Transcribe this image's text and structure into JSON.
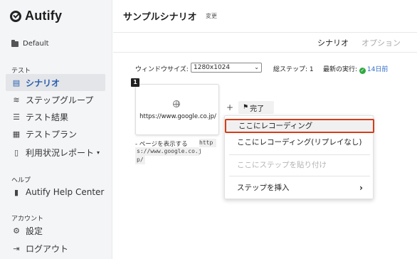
{
  "app": {
    "brand": "Autify"
  },
  "sidebar": {
    "project": "Default",
    "section_test": "テスト",
    "items": [
      {
        "label": "シナリオ",
        "icon": "scenario-icon"
      },
      {
        "label": "ステップグループ",
        "icon": "layers-icon"
      },
      {
        "label": "テスト結果",
        "icon": "list-icon"
      },
      {
        "label": "テストプラン",
        "icon": "calendar-icon"
      },
      {
        "label": "利用状況レポート",
        "icon": "report-icon",
        "caret": "▾"
      }
    ],
    "section_help": "ヘルプ",
    "help_item": "Autify Help Center",
    "section_account": "アカウント",
    "account_items": [
      {
        "label": "設定",
        "icon": "gear-icon"
      },
      {
        "label": "ログアウト",
        "icon": "logout-icon"
      }
    ]
  },
  "header": {
    "title": "サンプルシナリオ",
    "edit": "変更"
  },
  "tabs": {
    "scenario": "シナリオ",
    "option": "オプション"
  },
  "info": {
    "window_size_label": "ウィンドウサイズ:",
    "window_size_value": "1280x1024",
    "total_steps_label": "総ステップ:",
    "total_steps_value": "1",
    "last_run_label": "最新の実行:",
    "last_run_value": "14日前"
  },
  "step": {
    "number": "1",
    "url": "https://www.google.co.jp/",
    "desc_prefix": "- ページを表示する",
    "code_part1": "http",
    "code_part2": "s://www.google.co.j",
    "code_part3": "p/"
  },
  "toolbar": {
    "add": "+",
    "finish": "完了"
  },
  "menu": {
    "record_here": "ここにレコーディング",
    "record_here_replay": "ここにレコーディング(リプレイなし)",
    "paste_step": "ここにステップを貼り付け",
    "insert_step": "ステップを挿入"
  },
  "colors": {
    "accent_blue": "#2a5db0",
    "highlight_border": "#d43d1a",
    "success_green": "#2eaa3f"
  }
}
